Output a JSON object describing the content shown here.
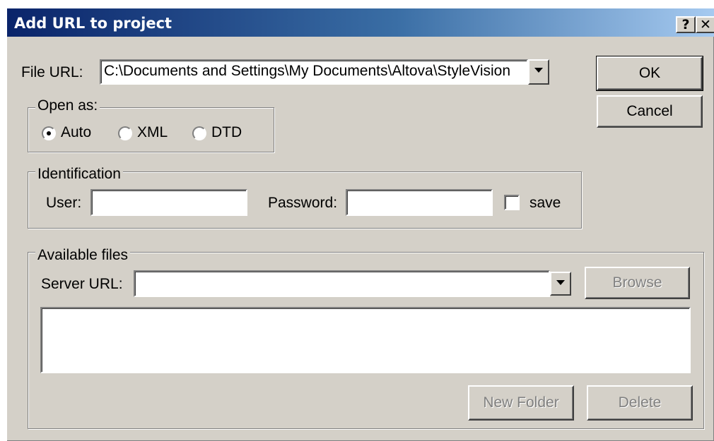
{
  "dialog": {
    "title": "Add URL to project",
    "help_label": "?",
    "close_label": "✕",
    "titlebar_colors": [
      "#0a246a",
      "#a6caf0"
    ]
  },
  "file_url": {
    "label": "File URL:",
    "value": "C:\\Documents and Settings\\My Documents\\Altova\\StyleVision"
  },
  "open_as": {
    "legend": "Open as:",
    "options": [
      {
        "label": "Auto",
        "selected": true
      },
      {
        "label": "XML",
        "selected": false
      },
      {
        "label": "DTD",
        "selected": false
      }
    ]
  },
  "identification": {
    "legend": "Identification",
    "user_label": "User:",
    "user_value": "",
    "password_label": "Password:",
    "password_value": "",
    "save_label": "save",
    "save_checked": false
  },
  "available_files": {
    "legend": "Available files",
    "server_url_label": "Server URL:",
    "server_url_value": "",
    "browse_label": "Browse",
    "new_folder_label": "New Folder",
    "delete_label": "Delete"
  },
  "buttons": {
    "ok_label": "OK",
    "cancel_label": "Cancel"
  }
}
